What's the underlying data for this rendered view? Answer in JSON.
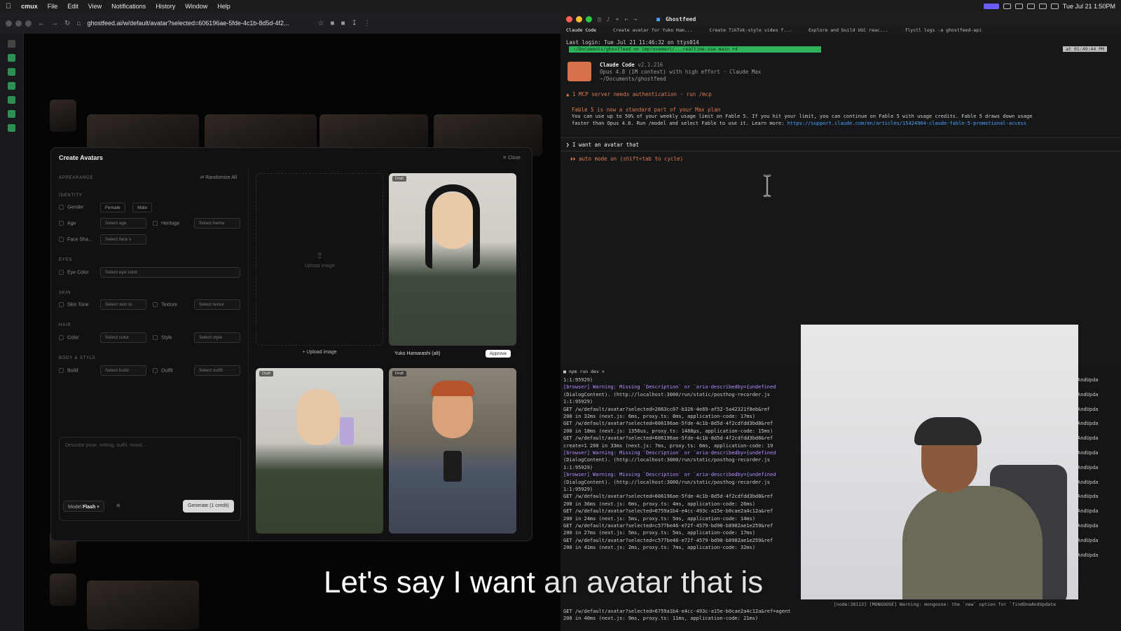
{
  "menubar": {
    "app": "cmux",
    "items": [
      "File",
      "Edit",
      "View",
      "Notifications",
      "History",
      "Window",
      "Help"
    ],
    "clock": "Tue Jul 21 1:50PM"
  },
  "browser": {
    "url": "ghostfeed.ai/w/default/avatar?selected=606196ae-5fde-4c1b-8d5d-4f2...",
    "modal": {
      "title": "Create Avatars",
      "close": "Close",
      "randomize": "Randomize All",
      "sections": {
        "appearance": "APPEARANCE",
        "identity": "IDENTITY",
        "eyes": "EYES",
        "skin": "SKIN",
        "hair": "HAIR",
        "body": "BODY & STYLE"
      },
      "fields": {
        "gender": "Gender",
        "female": "Female",
        "male": "Male",
        "age": "Age",
        "age_sel": "Select age",
        "heritage": "Heritage",
        "heritage_sel": "Select herita",
        "face": "Face Sha...",
        "face_sel": "Select face s",
        "eye": "Eye Color",
        "eye_sel": "Select eye color",
        "skin": "Skin Tone",
        "skin_sel": "Select skin to",
        "texture": "Texture",
        "texture_sel": "Select textur",
        "color": "Color",
        "color_sel": "Select color",
        "style": "Style",
        "style_sel": "Select style",
        "build": "Build",
        "build_sel": "Select build",
        "outfit": "Outfit",
        "outfit_sel": "Select outfit"
      },
      "prompt_placeholder": "Describe pose, setting, outfit, mood...",
      "model_label": "Model",
      "model_value": "Flash",
      "generate": "Generate (1 credit)",
      "upload_area": "Upload image",
      "upload_button": "+ Upload image",
      "cards": [
        {
          "badge": "Draft",
          "name": "Yuko Hamarashi (alt)",
          "action": "Approve"
        },
        {
          "badge": "Draft"
        },
        {
          "badge": "Draft"
        }
      ]
    }
  },
  "terminal": {
    "title": "Ghostfeed",
    "tabs": [
      "Claude Code",
      "Create avatar for Yuko Ham...",
      "Create TikTok-style video f...",
      "Explore and build UGC reac...",
      "flyctl logs -a ghostfeed-api"
    ],
    "last_login": "Last login: Tue Jul 21 11:46:32 on ttys014",
    "path": "~/Documents/ghostfeed  on  improvement/...realtime-sse main +4",
    "time_chip": "at 01:49:44 PM",
    "claude_title": "Claude Code",
    "claude_version": "v2.1.216",
    "claude_model": "Opus 4.8 (1M context) with high effort · Claude Max",
    "claude_path": "~/Documents/ghostfeed",
    "mcp_warning": "▲ 1 MCP server needs authentication · run /mcp",
    "fable_line1": "Fable 5 is now a standard part of your Max plan",
    "fable_line2": "You can use up to 50% of your weekly usage limit on Fable 5. If you hit your limit, you can continue on Fable 5 with usage credits. Fable 5 draws down usage",
    "fable_line3": "faster than Opus 4.8. Run /model and select Fable to use it. Learn more: ",
    "fable_link": "https://support.claude.com/en/articles/15424964-claude-fable-5-promotional-access",
    "prompt": "❯ I want an avatar that",
    "auto_mode": "⏵⏵ auto mode on (shift+tab to cycle)",
    "pane2_tab": "npm run dev",
    "logs": [
      "1:1:95929)",
      "[browser] Warning: Missing `Description` or `aria-describedby={undefined",
      "(DialogContent). (http://localhost:3000/run/static/posthog-recorder.js",
      "1:1:95929)",
      " GET /w/default/avatar?selected=2863cc07-b326-4e89-af52-5a42321f8eb&ref",
      "200 in 32ms (next.js: 6ms, proxy.ts: 8ms, application-code: 17ms)",
      " GET /w/default/avatar?selected=606196ae-5fde-4c1b-8d5d-4f2cdfdd3bd8&ref",
      "200 in 18ms (next.js: 1356us, proxy.ts: 1488µs, application-code: 15ms)",
      " GET /w/default/avatar?selected=606196ae-5fde-4c1b-8d5d-4f2cdfdd3bd8&ref",
      "create=1 200 in 33ms (next.js: 7ms, proxy.ts: 6ms, application-code: 19",
      "[browser] Warning: Missing `Description` or `aria-describedby={undefined",
      "(DialogContent). (http://localhost:3000/run/static/posthog-recorder.js",
      "1:1:95929)",
      "[browser] Warning: Missing `Description` or `aria-describedby={undefined",
      "(DialogContent). (http://localhost:3000/run/static/posthog-recorder.js",
      "1:1:95929)",
      " GET /w/default/avatar?selected=606196ae-5fde-4c1b-8d5d-4f2cdfdd3bd8&ref",
      "200 in 36ms (next.js: 6ms, proxy.ts: 4ms, application-code: 26ms)",
      " GET /w/default/avatar?selected=6759a1b4-e4cc-493c-a15e-b0cae2a4c12a&ref",
      "200 in 24ms (next.js: 5ms, proxy.ts: 5ms, application-code: 14ms)",
      " GET /w/default/avatar?selected=c577be46-e72f-4579-bd90-b8902ae1e259&ref",
      "200 in 27ms (next.js: 5ms, proxy.ts: 5ms, application-code: 17ms)",
      " GET /w/default/avatar?selected=c577be46-e72f-4579-bd90-b8902ae1e259&ref",
      "200 in 41ms (next.js: 2ms, proxy.ts: 7ms, application-code: 32ms)"
    ],
    "bottom_log1": "[node:38113] [MONGOOSE] Warning: mongoose: the `new` option for `findOneAndUpdate",
    "bottom_log2": "GET /w/default/avatar?selected=6759a1b4-e4cc-493c-a15e-b0cae2a4c12a&ref=agent",
    "bottom_log3": "200 in 40ms (next.js: 9ms, proxy.ts: 11ms, application-code: 21ms)",
    "right_snippet": "AndUpda"
  },
  "subtitle": {
    "part1": "Let's say I want ",
    "part2": "an avatar that is"
  }
}
